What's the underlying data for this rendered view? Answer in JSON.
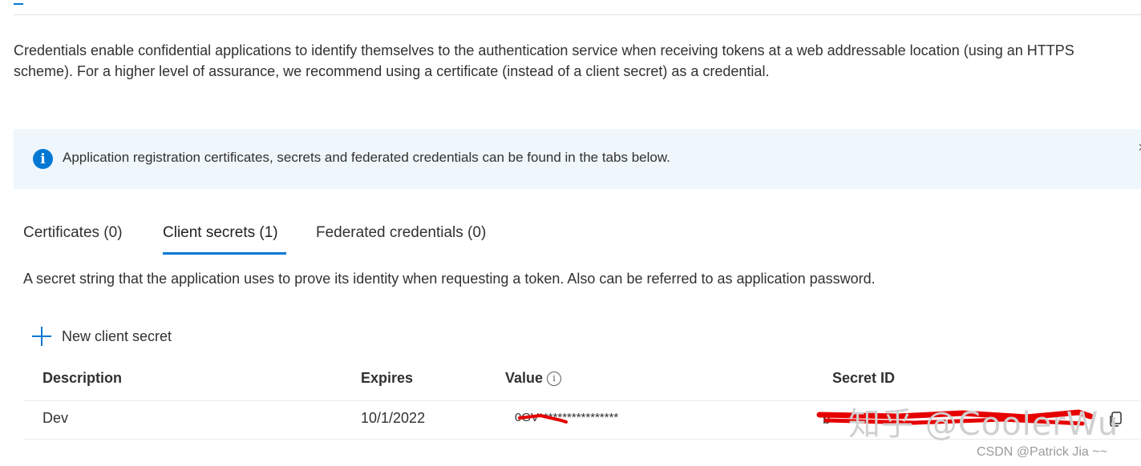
{
  "intro": {
    "text_line1": "Credentials enable confidential applications to identify themselves to the authentication service when receiving tokens at a web addressable location (using an HTTPS",
    "text_line2": "scheme). For a higher level of assurance, we recommend using a certificate (instead of a client secret) as a credential."
  },
  "banner": {
    "icon": "info-icon",
    "text": "Application registration certificates, secrets and federated credentials can be found in the tabs below."
  },
  "tabs": [
    {
      "label": "Certificates (0)"
    },
    {
      "label": "Client secrets (1)",
      "active": true
    },
    {
      "label": "Federated credentials (0)"
    }
  ],
  "client_secrets": {
    "description": "A secret string that the application uses to prove its identity when requesting a token. Also can be referred to as application password.",
    "new_button_label": "New client secret",
    "columns": [
      "Description",
      "Expires",
      "Value",
      "Secret ID"
    ],
    "rows": [
      {
        "description": "Dev",
        "expires": "10/1/2022",
        "value": "0GV*****************",
        "secret_id": "b"
      }
    ]
  },
  "overlays": {
    "watermark_text": "知乎 @CoolerWu",
    "source_text": "CSDN @Patrick Jia ~~"
  },
  "colors": {
    "accent": "#0078d4",
    "banner_bg": "#eff6fc",
    "redaction": "#e60000"
  }
}
